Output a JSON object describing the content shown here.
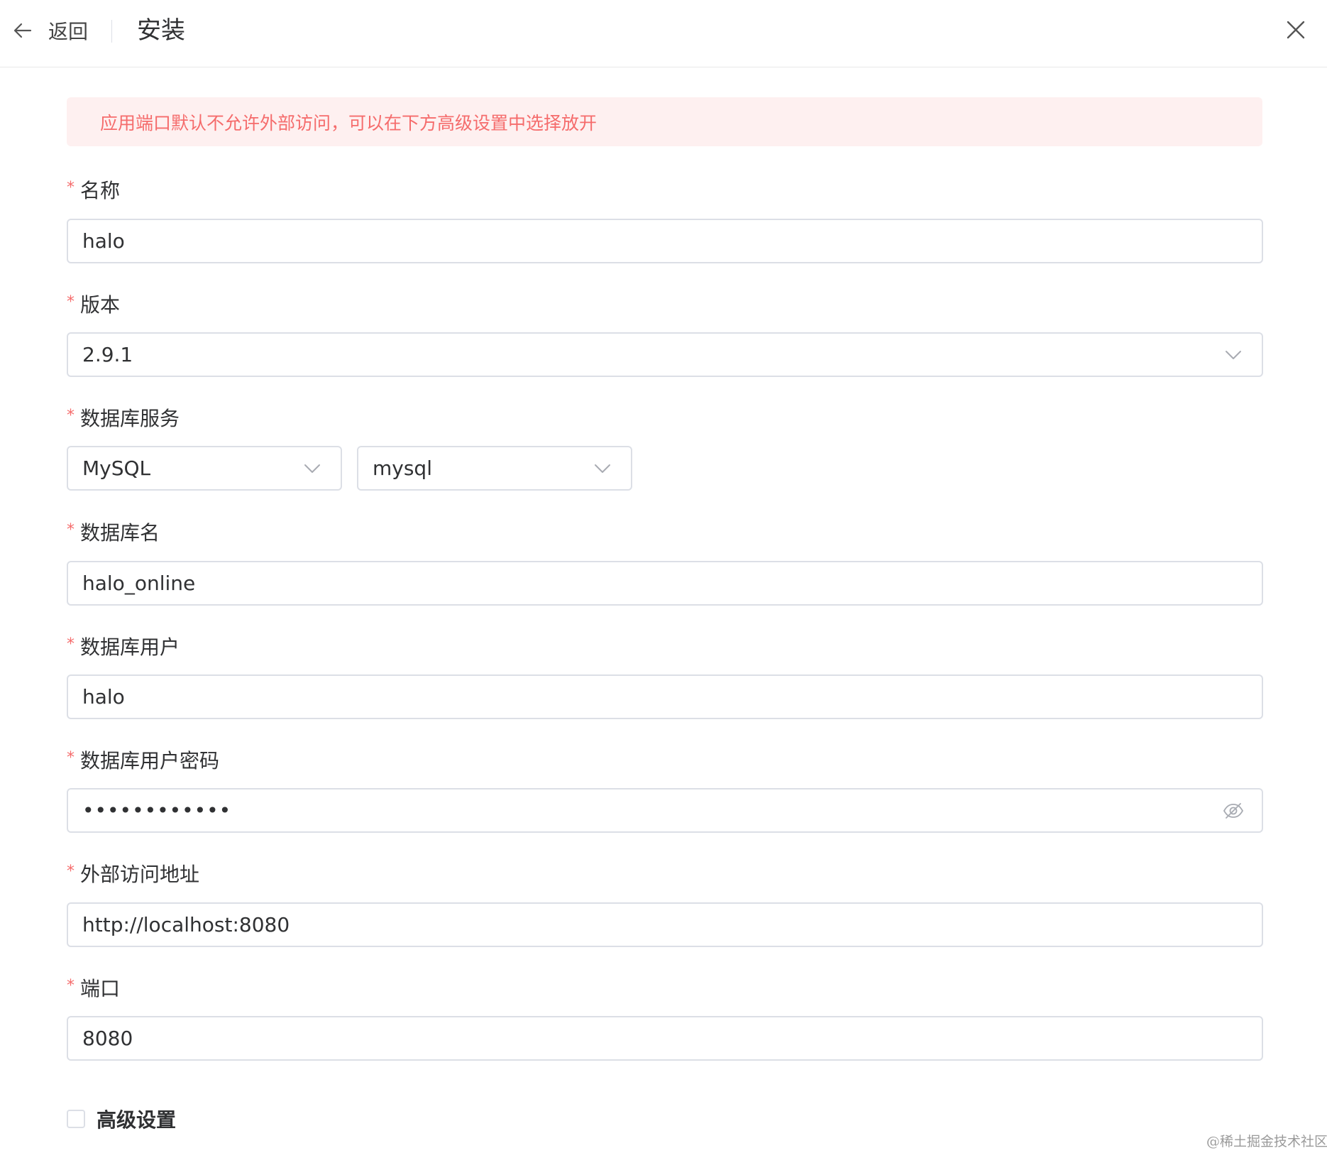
{
  "header": {
    "back_label": "返回",
    "title": "安装"
  },
  "alert": {
    "text": "应用端口默认不允许外部访问，可以在下方高级设置中选择放开"
  },
  "form": {
    "required_mark": "*",
    "name": {
      "label": "名称",
      "value": "halo"
    },
    "version": {
      "label": "版本",
      "value": "2.9.1"
    },
    "db_service": {
      "label": "数据库服务",
      "type_value": "MySQL",
      "instance_value": "mysql"
    },
    "db_name": {
      "label": "数据库名",
      "value": "halo_online"
    },
    "db_user": {
      "label": "数据库用户",
      "value": "halo"
    },
    "db_password": {
      "label": "数据库用户密码",
      "masked_value": "••••••••••••"
    },
    "external_url": {
      "label": "外部访问地址",
      "value": "http://localhost:8080"
    },
    "port": {
      "label": "端口",
      "value": "8080"
    },
    "advanced": {
      "label": "高级设置",
      "checked": false
    }
  },
  "watermark": "@稀土掘金技术社区",
  "colors": {
    "required": "#f56c6c",
    "alert_bg": "#fef0f0",
    "alert_text": "#f56c6c",
    "border": "#dcdfe6"
  },
  "icons": {
    "back": "arrow-left-icon",
    "close": "close-icon",
    "dropdown": "chevron-down-icon",
    "password_toggle": "eye-off-icon"
  }
}
